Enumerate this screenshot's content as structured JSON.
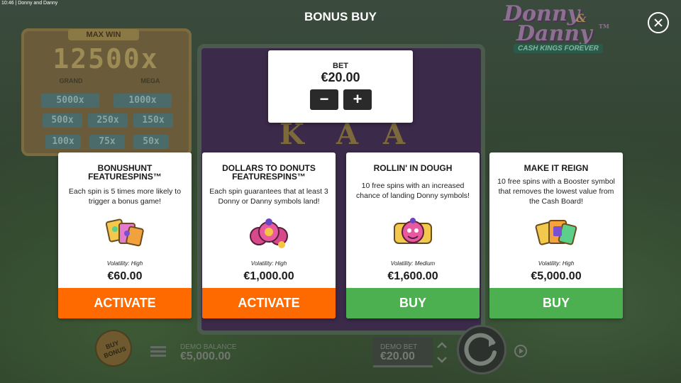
{
  "window": {
    "title": "10:46 | Donny and Danny"
  },
  "header": {
    "title": "BONUS BUY",
    "close_icon": "close-icon"
  },
  "background": {
    "jackpot": {
      "max_win_label": "MAX WIN",
      "max_win_value": "12500x",
      "grand_label": "GRAND",
      "mega_label": "MEGA",
      "values": [
        "5000x",
        "1000x",
        "500x",
        "250x",
        "150x",
        "100x",
        "75x",
        "50x"
      ]
    },
    "logo": {
      "line1": "Donny",
      "amp": "&",
      "line2": "Danny",
      "tm": "TM",
      "tagline": "CASH KINGS FOREVER"
    },
    "reel_letters": [
      "K",
      "A",
      "A"
    ]
  },
  "bet": {
    "label": "BET",
    "value": "€20.00",
    "minus_label": "−",
    "plus_label": "+"
  },
  "cards": [
    {
      "title_line1": "BONUSHUNT",
      "title_line2": "FEATURESPINS™",
      "description": "Each spin is 5 times more likely to trigger a bonus game!",
      "volatility": "Volatility: High",
      "price": "€60.00",
      "button_label": "ACTIVATE",
      "button_color": "#ff6a00",
      "icon": "bonus-cards-icon"
    },
    {
      "title_line1": "DOLLARS TO DONUTS",
      "title_line2": "FEATURESPINS™",
      "description": "Each spin guarantees that at least 3 Donny or Danny symbols land!",
      "volatility": "Volatility: High",
      "price": "€1,000.00",
      "button_label": "ACTIVATE",
      "button_color": "#ff6a00",
      "icon": "donut-coins-icon"
    },
    {
      "title_line1": "ROLLIN' IN DOUGH",
      "title_line2": "",
      "description": "10 free spins with an increased chance of landing Donny symbols!",
      "volatility": "Volatility: Medium",
      "price": "€1,600.00",
      "button_label": "BUY",
      "button_color": "#4caf50",
      "icon": "donny-badge-icon"
    },
    {
      "title_line1": "MAKE IT REIGN",
      "title_line2": "",
      "description": "10 free spins with a Booster symbol that removes the lowest value from the Cash Board!",
      "volatility": "Volatility: High",
      "price": "€5,000.00",
      "button_label": "BUY",
      "button_color": "#4caf50",
      "icon": "booster-cards-icon"
    }
  ],
  "footer": {
    "buy_bonus_label": "BUY BONUS",
    "demo_balance_label": "DEMO BALANCE",
    "demo_balance": "€5,000.00",
    "demo_bet_label": "DEMO BET",
    "demo_bet": "€20.00"
  },
  "colors": {
    "activate": "#ff6a00",
    "buy": "#4caf50",
    "panel": "#ffffff",
    "stepper": "#2a2a2a"
  }
}
